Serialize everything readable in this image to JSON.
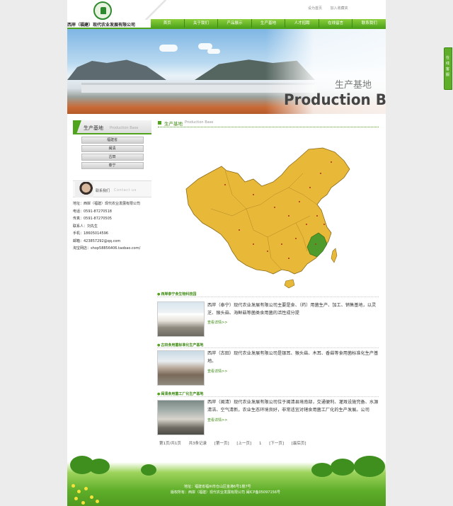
{
  "header": {
    "company_name": "西岸（福建）现代农业发展有限公司",
    "top_links": [
      "设为首页",
      "加入收藏夹"
    ]
  },
  "nav": {
    "items": [
      "首页",
      "关于我们",
      "产品展示",
      "生产基地",
      "人才招聘",
      "在线留言",
      "联系我们"
    ],
    "active_index": 3
  },
  "banner": {
    "title_cn": "生产基地",
    "title_en": "Production Base"
  },
  "sidebar": {
    "title": "生产基地",
    "subtitle": "Production Base",
    "items": [
      "福建省",
      "闽清",
      "古田",
      "泰宁"
    ],
    "contact": {
      "title": "联系我们",
      "title_en": "Contact us",
      "lines": [
        "地址：西岸（福建）现代农业发展有限公司",
        "电话：0591-87270518",
        "传真：0591-87270505",
        "联系人：刘先生",
        "手机：18605014596",
        "邮箱：423857292@qq.com",
        "淘宝网店：shop58856406.taobao.com/"
      ]
    }
  },
  "main": {
    "title": "生产基地",
    "subtitle": "Production Base"
  },
  "products": [
    {
      "title": "西岸泰宁食生物科技园",
      "text": "西岸（泰宁）现代农业发展有限公司主要是食、（药）用菌生产、加工、销售基地，以灵芝、猴头菇、海鲜菇等菌类食用菌的活性成分提",
      "more": "查看详情>>"
    },
    {
      "title": "古田食用菌标准化生产基地",
      "text": "西岸（古田）现代农业发展有限公司是银耳、猴头菇、木耳、香菇等食用菌标准化生产基地。",
      "more": "查看详情>>"
    },
    {
      "title": "闽清食用菌工厂化生产基地",
      "text": "西岸（闽清）现代农业发展有限公司位于闽清县境南部，交通便利、灌溉设施完备、水源清洁、空气清新，农业生态环境良好，非常适宜对辖食用菌工厂化的生产发展。公司",
      "more": "查看详情>>"
    }
  ],
  "pager": [
    "第1页/共1页",
    "共3条记录",
    "[第一页]",
    "[上一页]",
    "1",
    "[下一页]",
    "[最后页]"
  ],
  "footer": {
    "line1": "地址：福建省福州市仓山区金港6号1楼7号",
    "line2": "版权所有：西岸（福建）现代农业发展有限公司 闽ICP备05097156号"
  },
  "side_tab": {
    "label": "在线客服"
  },
  "colors": {
    "accent": "#4fa41c",
    "nav_top": "#8ccf3a",
    "map_fill": "#e8b838",
    "map_highlight": "#4e9a2a"
  }
}
